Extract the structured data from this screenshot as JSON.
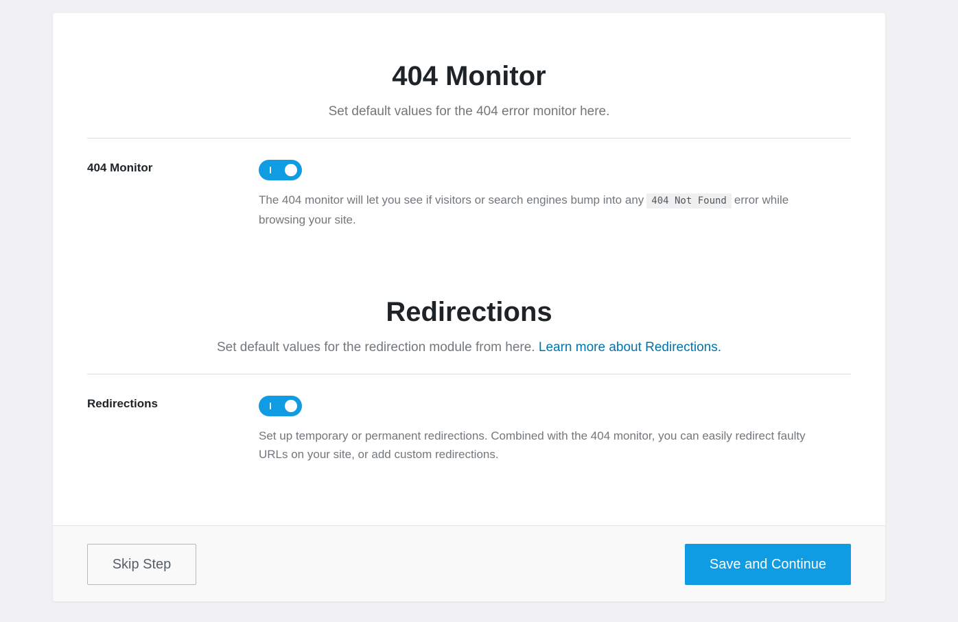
{
  "monitor_section": {
    "title": "404 Monitor",
    "description": "Set default values for the 404 error monitor here.",
    "setting": {
      "label": "404 Monitor",
      "enabled": true,
      "help_before": "The 404 monitor will let you see if visitors or search engines bump into any",
      "help_code": "404 Not Found",
      "help_after": "error while browsing your site."
    }
  },
  "redirections_section": {
    "title": "Redirections",
    "description": "Set default values for the redirection module from here.",
    "link_text": "Learn more about Redirections.",
    "setting": {
      "label": "Redirections",
      "enabled": true,
      "help": "Set up temporary or permanent redirections. Combined with the 404 monitor, you can easily redirect faulty URLs on your site, or add custom redirections."
    }
  },
  "footer": {
    "skip_label": "Skip Step",
    "save_label": "Save and Continue"
  },
  "colors": {
    "accent": "#109ce3",
    "link": "#0073aa",
    "background": "#f1f1f3"
  }
}
